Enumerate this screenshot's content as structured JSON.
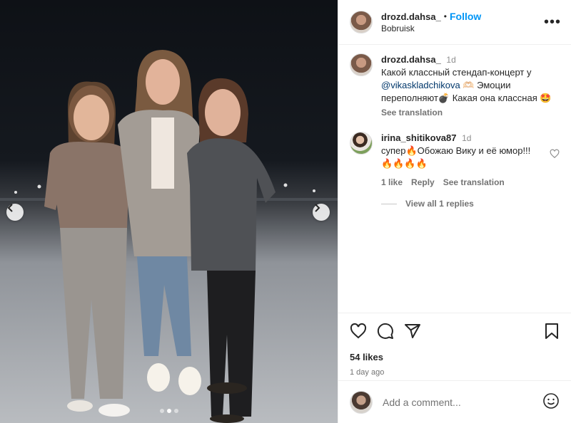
{
  "photo": {
    "alt": "Three women standing on a stage",
    "carousel": {
      "count": 3,
      "active": 1
    }
  },
  "header": {
    "username": "drozd.dahsa_",
    "bullet": "•",
    "follow": "Follow",
    "location": "Bobruisk",
    "more": "•••"
  },
  "caption": {
    "username": "drozd.dahsa_",
    "time": "1d",
    "text_before": "Какой классный стендап-концерт у ",
    "mention": "@vikaskladchikova",
    "text_after": " 🫶🏻 Эмоции переполняют💣 Какая она классная 🤩",
    "see_translation": "See translation"
  },
  "comment": {
    "username": "irina_shitikova87",
    "time": "1d",
    "text": "супер🔥Обожаю Вику и её юмор!!! 🔥🔥🔥🔥",
    "likes": "1 like",
    "reply": "Reply",
    "see_translation": "See translation",
    "view_replies": "View all 1 replies"
  },
  "post": {
    "likes": "54 likes",
    "date": "1 day ago"
  },
  "add_comment": {
    "placeholder": "Add a comment..."
  },
  "colors": {
    "accent": "#0095f6",
    "mention": "#00376b",
    "secondary_text": "#737373"
  }
}
